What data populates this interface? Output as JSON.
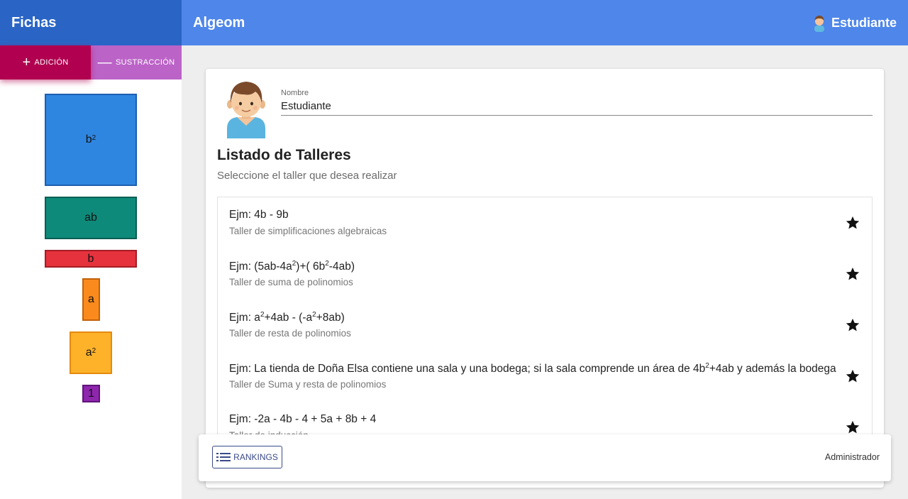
{
  "sidebar": {
    "title": "Fichas",
    "tabs": [
      {
        "symbol": "+",
        "label": "ADICIÓN"
      },
      {
        "symbol": "—",
        "label": "SUSTRACCIÓN"
      }
    ],
    "tiles": [
      {
        "base": "b",
        "exp": "2",
        "color": "#2f86e0"
      },
      {
        "base": "ab",
        "exp": "",
        "color": "#0e8a7a"
      },
      {
        "base": "b",
        "exp": "",
        "color": "#e5323d"
      },
      {
        "base": "a",
        "exp": "",
        "color": "#fb8a1d"
      },
      {
        "base": "a",
        "exp": "2",
        "color": "#fdb22a"
      },
      {
        "base": "1",
        "exp": "",
        "color": "#8e26ae"
      }
    ]
  },
  "topbar": {
    "title": "Algeom",
    "user": "Estudiante"
  },
  "profile": {
    "name_label": "Nombre",
    "name_value": "Estudiante"
  },
  "workshops": {
    "title": "Listado de Talleres",
    "subtitle": "Seleccione el taller que desea realizar",
    "items": [
      {
        "example_parts": [
          "Ejm: 4b - 9b"
        ],
        "description": "Taller de simplificaciones algebraicas"
      },
      {
        "example_parts": [
          "Ejm: (5ab-4a",
          "2",
          ")+( 6b",
          "2",
          "-4ab)"
        ],
        "description": "Taller de suma de polinomios"
      },
      {
        "example_parts": [
          "Ejm: a",
          "2",
          "+4ab - (-a",
          "2",
          "+8ab)"
        ],
        "description": "Taller de resta de polinomios"
      },
      {
        "example_parts": [
          "Ejm: La tienda de Doña Elsa contiene una sala y una bodega; si la sala comprende un área de 4b",
          "2",
          "+4ab y además la bodega"
        ],
        "description": "Taller de Suma y resta de polinomios"
      },
      {
        "example_parts": [
          "Ejm: -2a - 4b - 4 + 5a + 8b + 4"
        ],
        "description": "Taller de inducción"
      }
    ]
  },
  "footer": {
    "rankings_label": "RANKINGS",
    "admin_label": "Administrador"
  }
}
